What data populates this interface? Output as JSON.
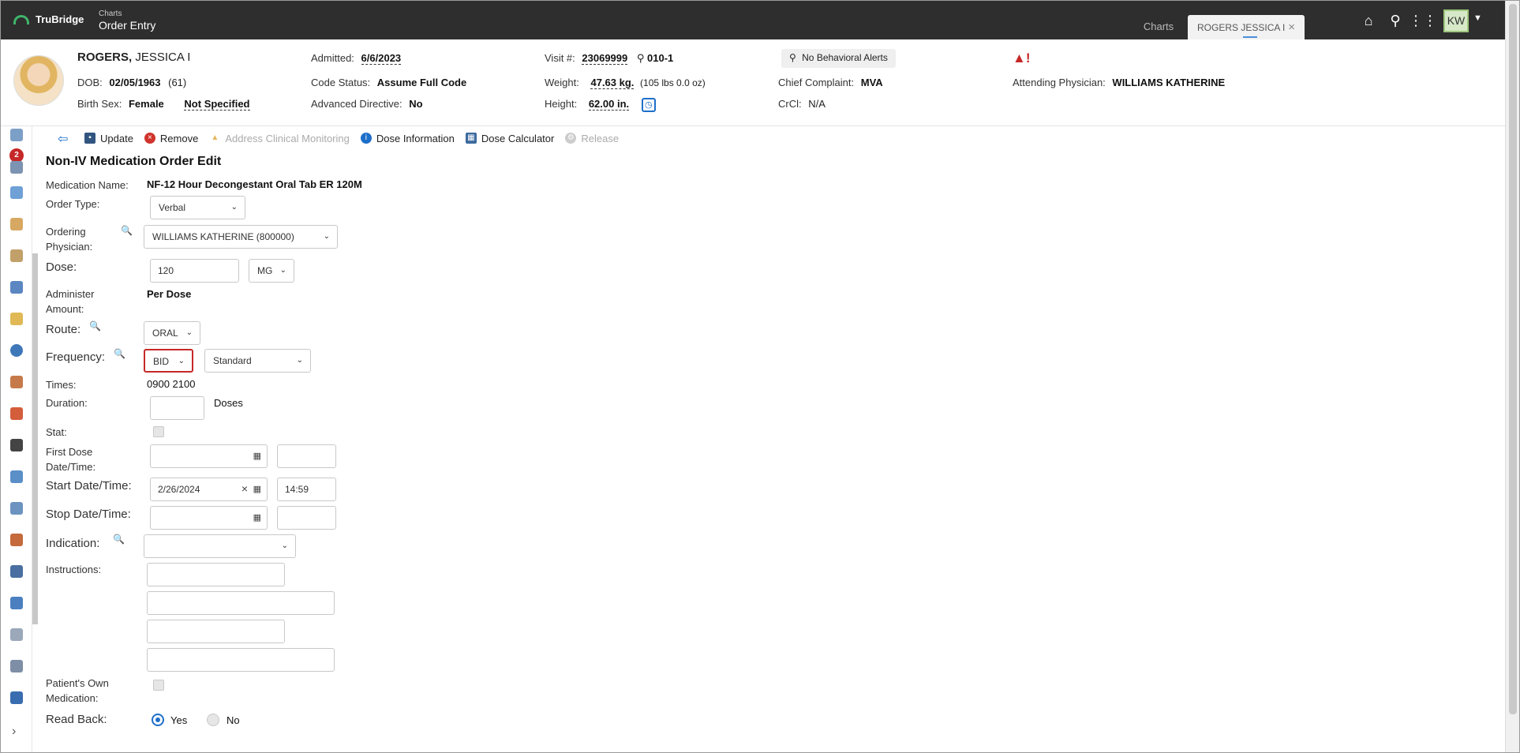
{
  "app": {
    "brand": "TruBridge",
    "crumb_small": "Charts",
    "crumb_big": "Order Entry"
  },
  "tabs": {
    "charts": "Charts",
    "patient_tab": "ROGERS JESSICA I"
  },
  "user": {
    "initials": "KW"
  },
  "patient": {
    "last_name": "ROGERS,",
    "first_name": "JESSICA I",
    "dob_label": "DOB:",
    "dob": "02/05/1963",
    "age": "(61)",
    "birth_sex_label": "Birth Sex:",
    "birth_sex": "Female",
    "gender_identity": "Not Specified",
    "admitted_label": "Admitted:",
    "admitted": "6/6/2023",
    "code_status_label": "Code Status:",
    "code_status": "Assume Full Code",
    "adv_directive_label": "Advanced Directive:",
    "adv_directive": "No",
    "visit_label": "Visit #:",
    "visit": "23069999",
    "room": "010-1",
    "weight_label": "Weight:",
    "weight": "47.63 kg.",
    "weight_lbs": "(105 lbs 0.0 oz)",
    "height_label": "Height:",
    "height": "62.00 in.",
    "behavioral_alert": "No Behavioral Alerts",
    "chief_complaint_label": "Chief Complaint:",
    "chief_complaint": "MVA",
    "crcl_label": "CrCl:",
    "crcl": "N/A",
    "attending_label": "Attending Physician:",
    "attending": "WILLIAMS KATHERINE",
    "alert_icon": "!"
  },
  "rail": {
    "badge_count": "2"
  },
  "toolbar": {
    "update": "Update",
    "remove": "Remove",
    "address": "Address Clinical Monitoring",
    "dose_info": "Dose Information",
    "dose_calc": "Dose Calculator",
    "release": "Release"
  },
  "form": {
    "title": "Non-IV Medication Order Edit",
    "medication_label": "Medication Name:",
    "medication": "NF-12 Hour Decongestant Oral Tab ER 120M",
    "order_type_label": "Order Type:",
    "order_type": "Verbal",
    "ordering_label_1": "Ordering",
    "ordering_label_2": "Physician:",
    "ordering_physician": "WILLIAMS KATHERINE (800000)",
    "dose_label": "Dose:",
    "dose": "120",
    "dose_unit": "MG",
    "administer_label_1": "Administer",
    "administer_label_2": "Amount:",
    "administer": "Per Dose",
    "route_label": "Route:",
    "route": "ORAL",
    "frequency_label": "Frequency:",
    "frequency": "BID",
    "frequency_type": "Standard",
    "times_label": "Times:",
    "times": "0900 2100",
    "duration_label": "Duration:",
    "duration": "",
    "duration_unit": "Doses",
    "stat_label": "Stat:",
    "first_dose_label_1": "First Dose",
    "first_dose_label_2": "Date/Time:",
    "start_label": "Start Date/Time:",
    "start_date": "2/26/2024",
    "start_time": "14:59",
    "stop_label": "Stop Date/Time:",
    "indication_label": "Indication:",
    "instructions_label": "Instructions:",
    "own_med_label_1": "Patient's Own",
    "own_med_label_2": "Medication:",
    "read_back_label": "Read Back:",
    "yes": "Yes",
    "no": "No"
  }
}
